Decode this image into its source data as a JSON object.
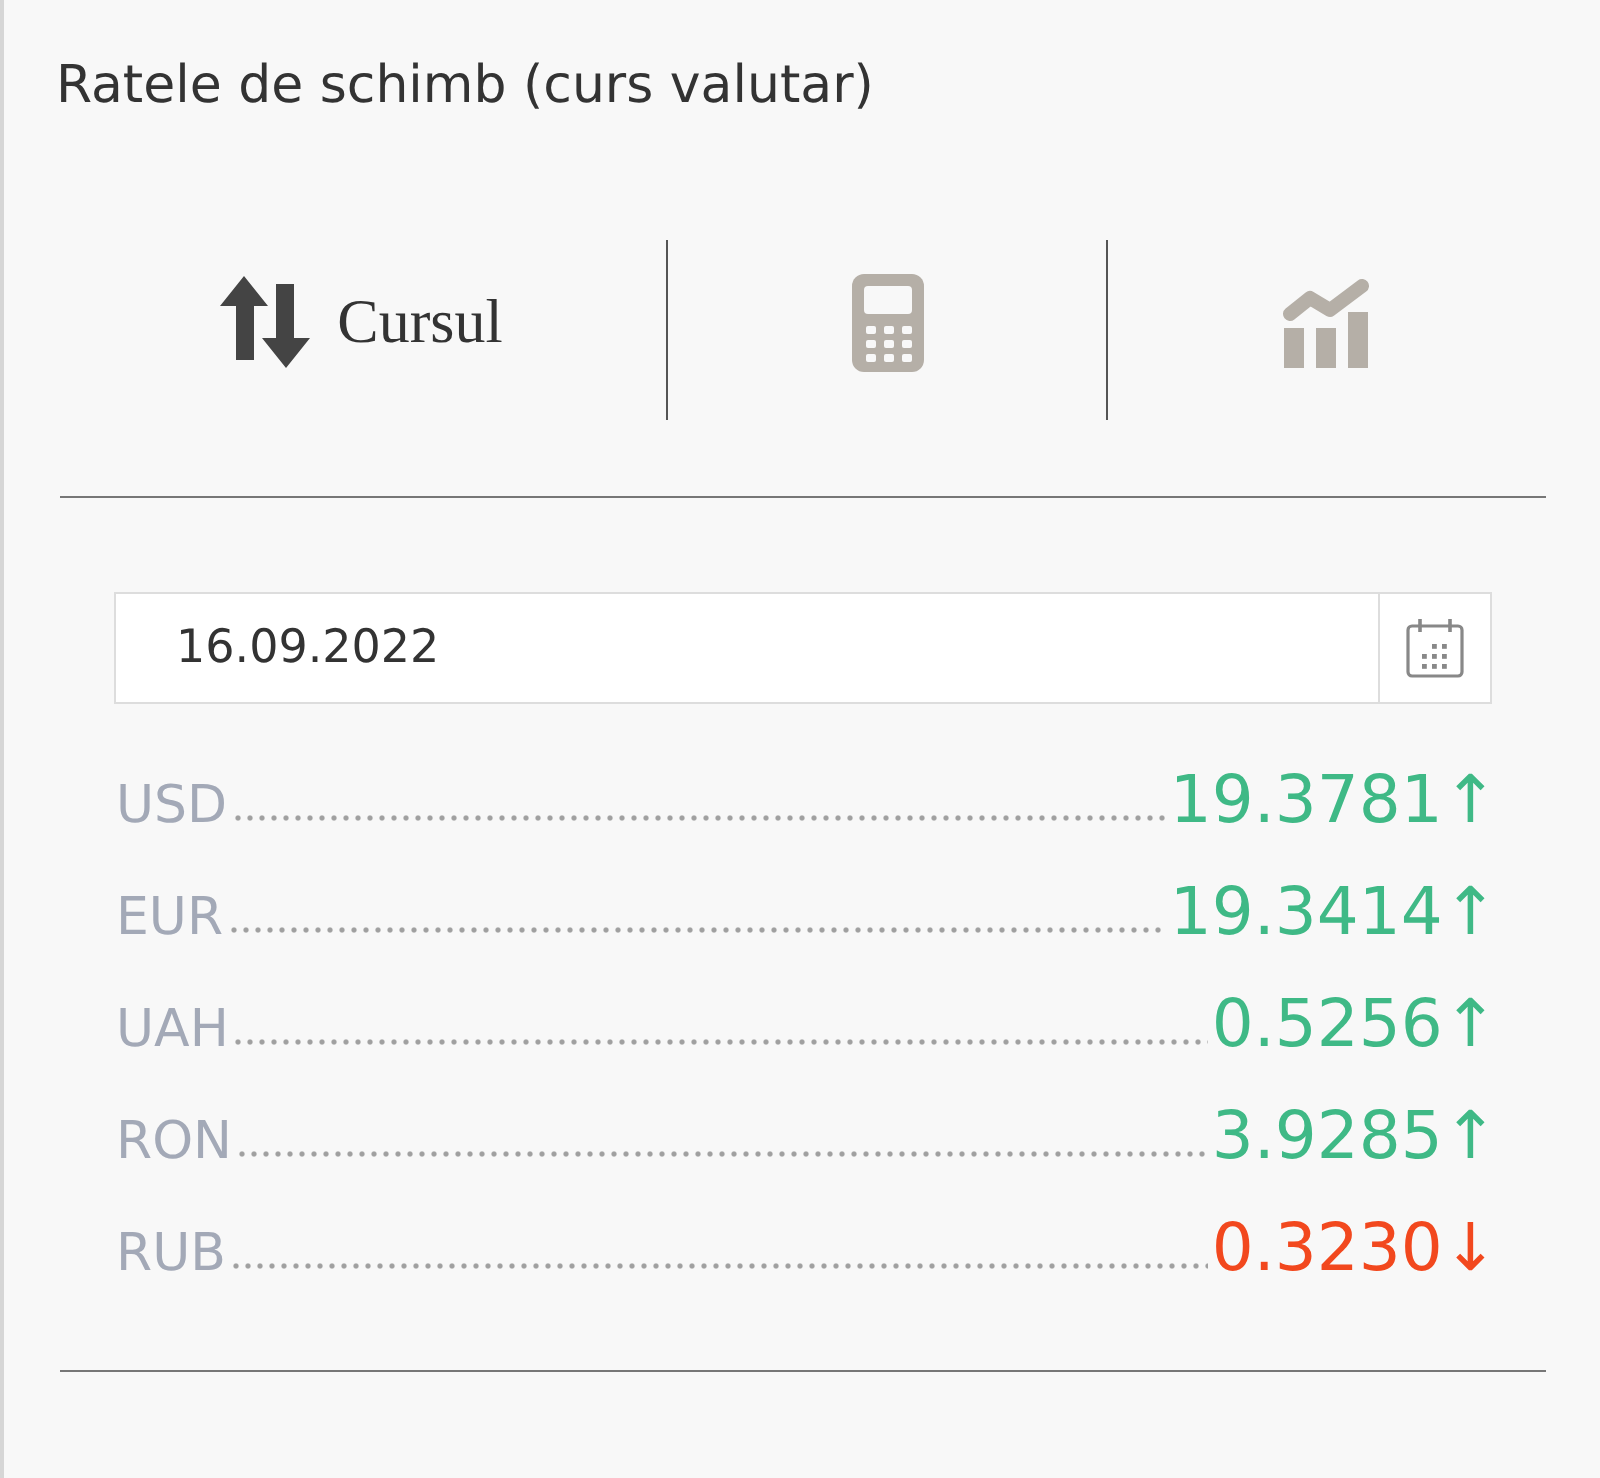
{
  "title": "Ratele de schimb (curs valutar)",
  "tabs": [
    {
      "kind": "rates",
      "label": "Cursul",
      "selected": true
    },
    {
      "kind": "calculator",
      "selected": false
    },
    {
      "kind": "chart",
      "selected": false
    }
  ],
  "date_field": {
    "value": "16.09.2022"
  },
  "rates": [
    {
      "currency": "USD",
      "value": "19.3781",
      "arrow": "↑",
      "color": "#3fb986"
    },
    {
      "currency": "EUR",
      "value": "19.3414",
      "arrow": "↑",
      "color": "#3fb986"
    },
    {
      "currency": "UAH",
      "value": "0.5256",
      "arrow": "↑",
      "color": "#3fb986"
    },
    {
      "currency": "RON",
      "value": "3.9285",
      "arrow": "↑",
      "color": "#3fb986"
    },
    {
      "currency": "RUB",
      "value": "0.3230",
      "arrow": "↓",
      "color": "#f2481e"
    }
  ]
}
